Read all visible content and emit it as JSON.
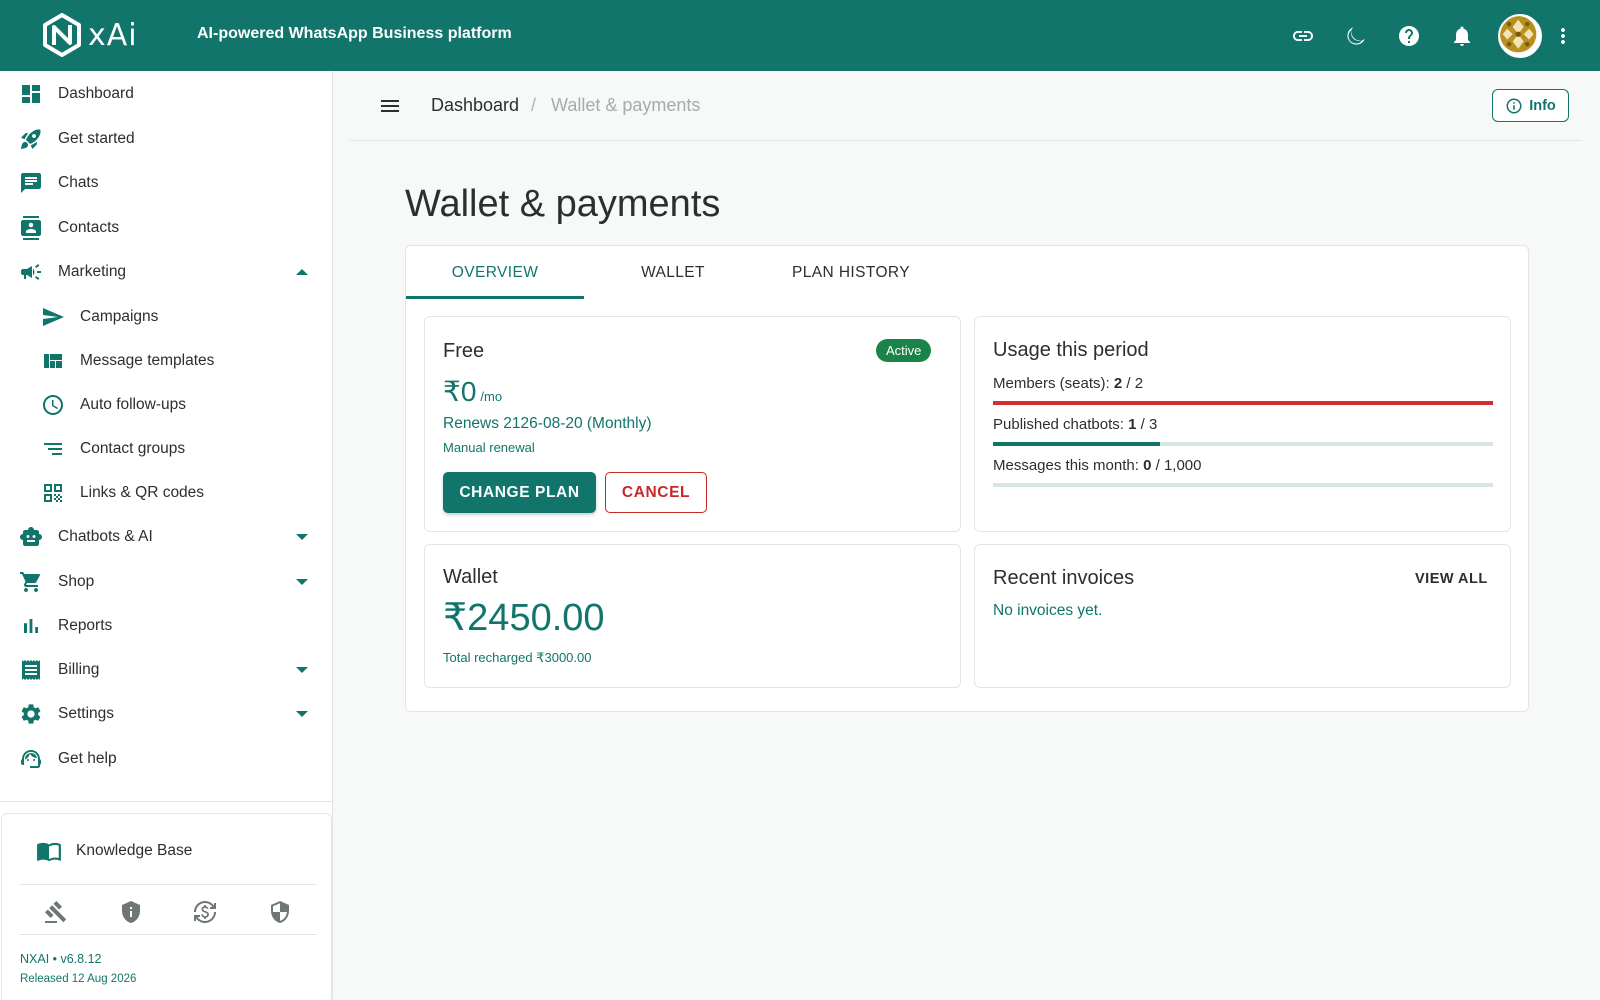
{
  "header": {
    "logo_text": "xAi",
    "tagline": "AI-powered WhatsApp Business platform",
    "icons": [
      "link-icon",
      "moon-icon",
      "help-icon",
      "bell-icon",
      "avatar",
      "more-vert-icon"
    ]
  },
  "sidebar": {
    "items": [
      {
        "label": "Dashboard",
        "icon": "dashboard-icon"
      },
      {
        "label": "Get started",
        "icon": "rocket-icon"
      },
      {
        "label": "Chats",
        "icon": "chat-icon"
      },
      {
        "label": "Contacts",
        "icon": "contacts-icon"
      },
      {
        "label": "Marketing",
        "icon": "campaign-icon",
        "expanded": true
      },
      {
        "label": "Campaigns",
        "icon": "send-icon"
      },
      {
        "label": "Message templates",
        "icon": "template-icon"
      },
      {
        "label": "Auto follow-ups",
        "icon": "clock-icon"
      },
      {
        "label": "Contact groups",
        "icon": "list-icon"
      },
      {
        "label": "Links & QR codes",
        "icon": "qr-icon"
      },
      {
        "label": "Chatbots & AI",
        "icon": "bot-icon",
        "expanded": false
      },
      {
        "label": "Shop",
        "icon": "cart-icon",
        "expanded": false
      },
      {
        "label": "Reports",
        "icon": "bar-chart-icon"
      },
      {
        "label": "Billing",
        "icon": "receipt-icon",
        "expanded": false
      },
      {
        "label": "Settings",
        "icon": "gear-icon",
        "expanded": false
      },
      {
        "label": "Get help",
        "icon": "support-agent-icon"
      }
    ],
    "knowledge_base": "Knowledge Base",
    "footer_icons": [
      "gavel-icon",
      "shield-info-icon",
      "currency-exchange-icon",
      "shield-icon"
    ],
    "version": "NXAI • v6.8.12",
    "released": "Released 12 Aug 2026"
  },
  "breadcrumb": {
    "root": "Dashboard",
    "separator": "/",
    "current": "Wallet & payments"
  },
  "info_button": "Info",
  "page_title": "Wallet & payments",
  "tabs": [
    {
      "label": "OVERVIEW",
      "active": true
    },
    {
      "label": "WALLET",
      "active": false
    },
    {
      "label": "PLAN HISTORY",
      "active": false
    }
  ],
  "plan": {
    "name": "Free",
    "status": "Active",
    "price": "₹0",
    "price_unit": "/mo",
    "renews": "Renews 2126-08-20 (Monthly)",
    "renewal_mode": "Manual renewal",
    "change_label": "CHANGE PLAN",
    "cancel_label": "CANCEL"
  },
  "usage": {
    "title": "Usage this period",
    "rows": [
      {
        "label": "Members (seats): ",
        "used": "2",
        "sep": " / ",
        "limit": "2",
        "fraction": 1.0,
        "color": "#d32f2f"
      },
      {
        "label": "Published chatbots: ",
        "used": "1",
        "sep": " / ",
        "limit": "3",
        "fraction": 0.333,
        "color": "#11756b"
      },
      {
        "label": "Messages this month: ",
        "used": "0",
        "sep": " / ",
        "limit": "1,000",
        "fraction": 0.0,
        "color": "#11756b"
      }
    ]
  },
  "wallet": {
    "title": "Wallet",
    "balance": "₹2450.00",
    "total_recharged": "Total recharged ₹3000.00"
  },
  "invoices": {
    "title": "Recent invoices",
    "view_all": "VIEW ALL",
    "empty": "No invoices yet."
  },
  "colors": {
    "brand": "#11756b",
    "danger": "#c62828",
    "success": "#1a8347"
  }
}
